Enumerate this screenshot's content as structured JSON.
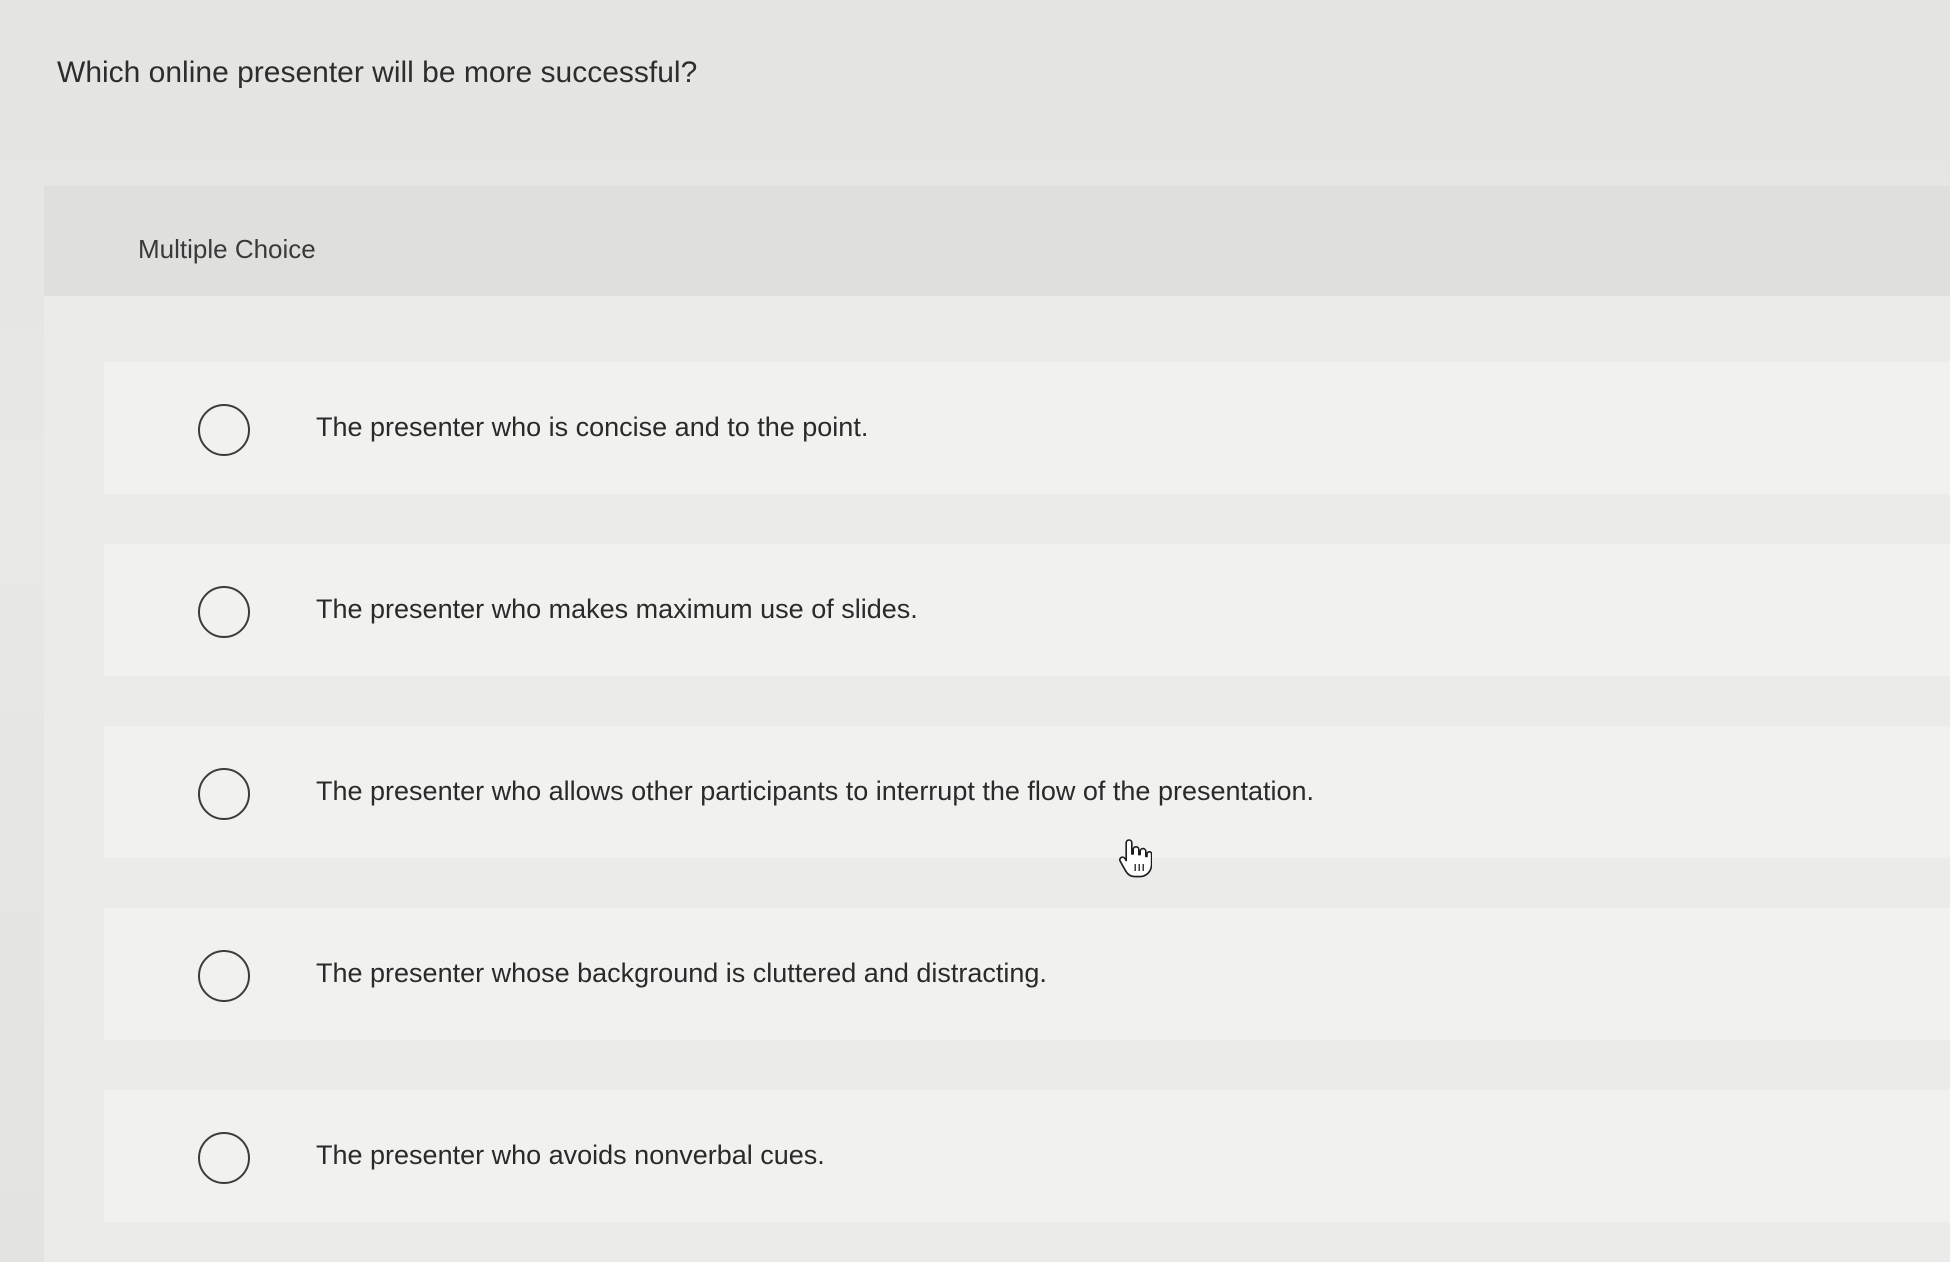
{
  "question": {
    "text": "Which online presenter will be more successful?"
  },
  "panel": {
    "type_label": "Multiple Choice"
  },
  "choices": [
    {
      "text": "The presenter who is concise and to the point.",
      "selected": false
    },
    {
      "text": "The presenter who makes maximum use of slides.",
      "selected": false
    },
    {
      "text": "The presenter who allows other participants to interrupt the flow of the presentation.",
      "selected": false
    },
    {
      "text": "The presenter whose background is cluttered and distracting.",
      "selected": false
    },
    {
      "text": "The presenter who avoids nonverbal cues.",
      "selected": false
    }
  ],
  "cursor": {
    "icon": "hand-pointer-icon"
  }
}
